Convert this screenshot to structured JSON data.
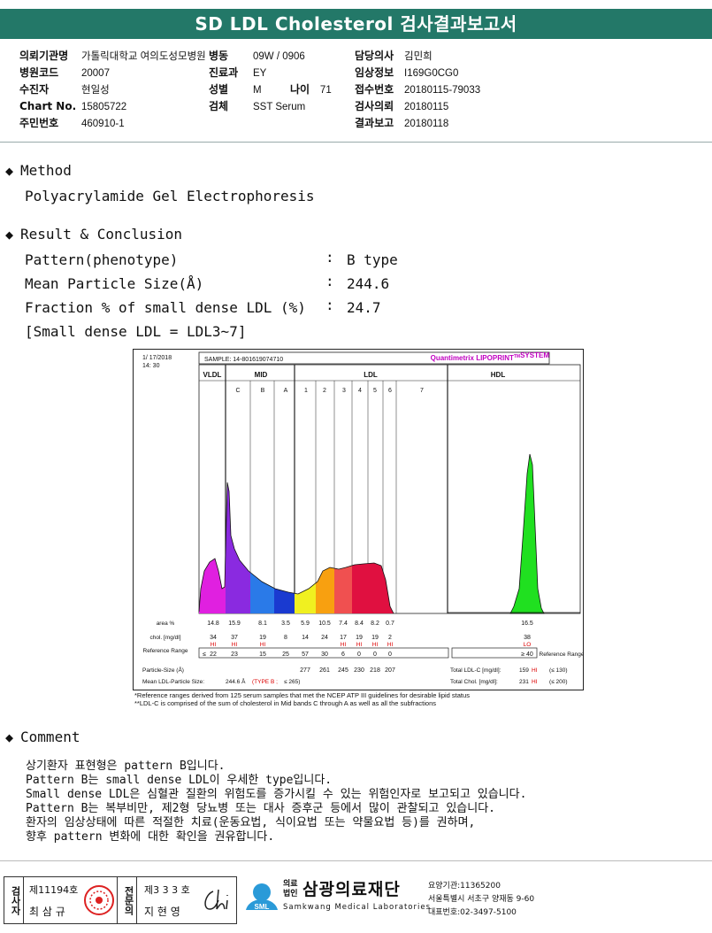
{
  "header": {
    "title": "SD LDL Cholesterol 검사결과보고서"
  },
  "patient": {
    "col1": [
      {
        "k": "의뢰기관명",
        "v": "가톨릭대학교 여의도성모병원"
      },
      {
        "k": "병원코드",
        "v": "20007"
      },
      {
        "k": "수진자",
        "v": "현일성"
      },
      {
        "k": "Chart No.",
        "v": "15805722"
      },
      {
        "k": "주민번호",
        "v": "460910-1"
      }
    ],
    "col2": [
      {
        "k": "병동",
        "v": "09W / 0906"
      },
      {
        "k": "진료과",
        "v": "EY"
      },
      {
        "k": "성별",
        "v": "M"
      },
      {
        "k": "검체",
        "v": "SST Serum"
      }
    ],
    "age": {
      "k": "나이",
      "v": "71"
    },
    "col3": [
      {
        "k": "담당의사",
        "v": "김민희"
      },
      {
        "k": "임상정보",
        "v": "I169G0CG0"
      },
      {
        "k": "접수번호",
        "v": "20180115-79033"
      },
      {
        "k": "검사의뢰",
        "v": "20180115"
      },
      {
        "k": "결과보고",
        "v": "20180118"
      }
    ]
  },
  "method": {
    "heading": "Method",
    "text": "Polyacrylamide Gel Electrophoresis"
  },
  "result": {
    "heading": "Result & Conclusion",
    "rows": [
      {
        "label": "Pattern(phenotype)",
        "colon": ":",
        "value": "B type"
      },
      {
        "label": "Mean Particle Size(Å)",
        "colon": ":",
        "value": "244.6"
      },
      {
        "label": "Fraction % of small dense LDL (%)",
        "colon": ":",
        "value": "24.7"
      }
    ],
    "note": "[Small dense LDL = LDL3~7]"
  },
  "chart_data": {
    "type": "area",
    "date": "1/ 17/2018",
    "time": "14: 30",
    "sample": "SAMPLE:  14-801619074710",
    "brand_prefix": "Quantimetrix ",
    "brand": "LIPOPRINT",
    "brand_tm": "TM",
    "brand_suffix": "SYSTEM",
    "groups": [
      "VLDL",
      "MID",
      "LDL",
      "HDL"
    ],
    "bands": [
      "C",
      "B",
      "A",
      "1",
      "2",
      "3",
      "4",
      "5",
      "6",
      "7"
    ],
    "row_labels": {
      "area": "area %",
      "chol": "chol. [mg/dl]",
      "ref": "Reference Range",
      "ps": "Particle-Size (Å)",
      "mean": "Mean LDL-Particle Size:"
    },
    "area_pct": [
      "14.8",
      "15.9",
      "8.1",
      "3.5",
      "5.9",
      "10.5",
      "7.4",
      "8.4",
      "8.2",
      "0.7",
      "16.5"
    ],
    "chol": [
      "34",
      "37",
      "19",
      "8",
      "14",
      "24",
      "17",
      "19",
      "19",
      "2",
      "38"
    ],
    "chol_flag": [
      "HI",
      "HI",
      "HI",
      "",
      "",
      "",
      "HI",
      "HI",
      "HI",
      "HI",
      "LO"
    ],
    "ref_prefix": "≤",
    "ref_range": [
      "22",
      "23",
      "15",
      "25",
      "57",
      "30",
      "6",
      "0",
      "0",
      "0"
    ],
    "ref_hdl": "≥ 40",
    "ref_side": "Reference Range",
    "particle_size": [
      "277",
      "261",
      "245",
      "230",
      "218",
      "207"
    ],
    "mean_value": "244.6 Å",
    "mean_type": "(TYPE B ;",
    "mean_type_end": "≤ 265)",
    "total_ldl_label": "Total LDL-C [mg/dl]:",
    "total_ldl": "159",
    "total_ldl_flag": "HI",
    "total_ldl_ref": "(≤ 130)",
    "total_chol_label": "Total Chol. [mg/dl]:",
    "total_chol": "231",
    "total_chol_flag": "HI",
    "total_chol_ref": "(≤ 200)",
    "footnote1": "*Reference ranges derived from 125 serum samples that met the NCEP ATP III guidelines for desirable lipid status",
    "footnote2": "**LDL-C is comprised of the sum of cholesterol in Mid bands C through A as well as all the subfractions",
    "colors": {
      "VLDL": "#e020e0",
      "MID_C": "#8a2ae0",
      "MID_B": "#2a7ae8",
      "MID_A": "#1a3ad0",
      "LDL1": "#f0f020",
      "LDL2": "#f8a010",
      "LDL3": "#f05050",
      "LDL4to7": "#e01040",
      "HDL": "#20e020"
    }
  },
  "comment": {
    "heading": "Comment",
    "lines": [
      "상기환자 표현형은 pattern B입니다.",
      "Pattern B는 small dense LDL이 우세한 type입니다.",
      "Small dense LDL은 심혈관 질환의 위험도를 증가시킬 수 있는 위험인자로 보고되고 있습니다.",
      "Pattern B는 복부비만, 제2형 당뇨병 또는 대사 증후군 등에서 많이 관찰되고 있습니다.",
      "환자의 임상상태에 따른 적절한 치료(운동요법, 식이요법 또는 약물요법 등)를 권하며,",
      "향후 pattern 변화에 대한 확인을 권유합니다."
    ]
  },
  "footer": {
    "sign1_role": "검사자",
    "sign1_no": "제11194호",
    "sign1_name": "최 삼 규",
    "sign2_role": "전문의",
    "sign2_no": "제3 3 3 호",
    "sign2_name": "지 현 영",
    "org_small1": "의료",
    "org_small2": "법인",
    "org_name": "삼광의료재단",
    "org_en": "Samkwang Medical Laboratories",
    "logo_text": "SML",
    "inst_no": "요양기관:11365200",
    "address": "서울특별시 서초구 양재동 9-60",
    "phone": "대표번호:02-3497-5100"
  }
}
